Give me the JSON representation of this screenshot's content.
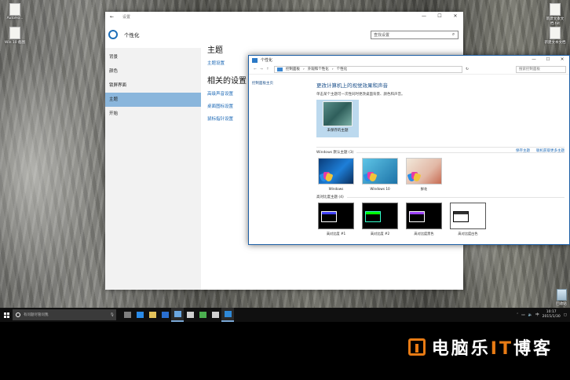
{
  "desktop": {
    "icons": [
      {
        "label": "AutoHo...",
        "kind": "doc"
      },
      {
        "label": "Win 10 截图",
        "kind": "doc"
      },
      {
        "label": "新建文本文档.txt",
        "kind": "doc"
      },
      {
        "label": "新建文本文档",
        "kind": "doc"
      },
      {
        "label": "回收站",
        "kind": "recycle"
      }
    ]
  },
  "settings": {
    "window_title": "设置",
    "app_title": "个性化",
    "search_placeholder": "查找设置",
    "nav": [
      "背景",
      "颜色",
      "锁屏界面",
      "主题",
      "开始"
    ],
    "active_index": 3,
    "section_title": "主题",
    "theme_settings_link": "主题设置",
    "related_title": "相关的设置",
    "related_links": [
      "高级声音设置",
      "桌面图标设置",
      "鼠标指针设置"
    ]
  },
  "cp": {
    "window_title": "个性化",
    "breadcrumb": [
      "控制面板",
      "外观和个性化",
      "个性化"
    ],
    "search_placeholder": "搜索控制面板",
    "side_link": "控制面板主页",
    "main_title": "更改计算机上的视觉效果和声音",
    "main_subtitle": "单击某个主题可一次性同时更改桌面背景、颜色和声音。",
    "unsaved_label": "未保存的主题",
    "save_theme": "保存主题",
    "get_more": "联机获取更多主题",
    "default_section": "Windows 默认主题 (3)",
    "default_themes": [
      "Windows",
      "Windows 10",
      "鲜花"
    ],
    "hc_section": "高对比度主题 (4)",
    "hc_themes": [
      "高对比度 #1",
      "高对比度 #2",
      "高对比度黑色",
      "高对比度白色"
    ],
    "hc_colors": [
      [
        "#ffffff",
        "#3f3fff"
      ],
      [
        "#33ffcc",
        "#00ff00"
      ],
      [
        "#ffffff",
        "#9a3fff"
      ],
      [
        "#000000",
        "#333333"
      ]
    ]
  },
  "taskbar": {
    "search_placeholder": "有问题尽管问我",
    "time": "10:17",
    "date": "2015/1/30",
    "app_icon_colors": [
      "#7e7e7e",
      "#2a8be8",
      "#e3c15a",
      "#2a6fd0",
      "#6aa6e0",
      "#cfcfcf",
      "#4caf50",
      "#cfcfcf",
      "#2f89d8"
    ]
  },
  "watermark": {
    "brand_pre": "电脑乐",
    "brand_it": "IT",
    "brand_post": "博客"
  }
}
